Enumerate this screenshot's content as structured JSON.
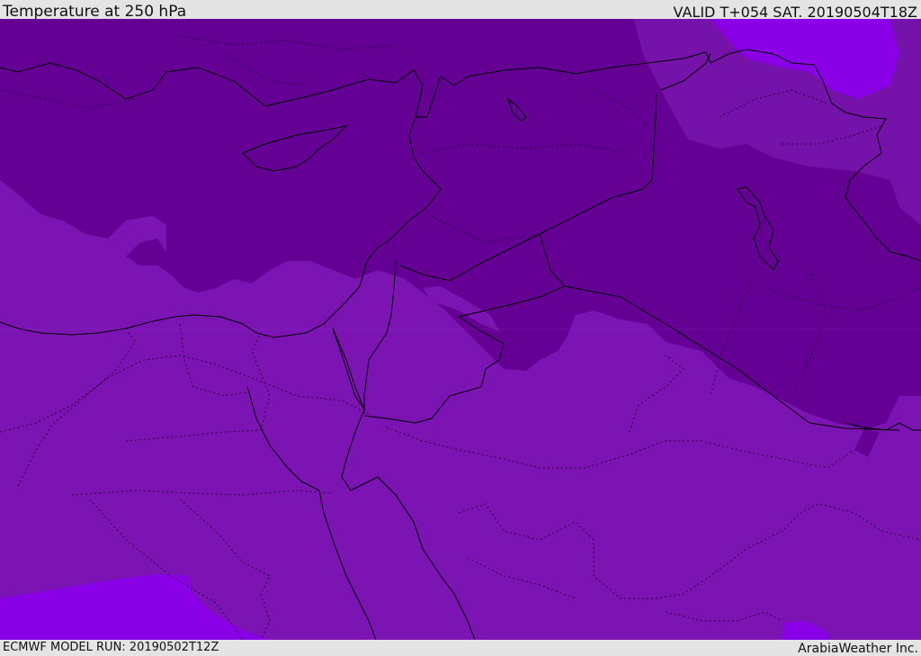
{
  "header": {
    "title": "Temperature at 250 hPa",
    "valid_time": "VALID T+054 SAT. 20190504T18Z"
  },
  "footer": {
    "model_run": "ECMWF MODEL RUN: 20190502T12Z",
    "credit": "ArabiaWeather Inc."
  },
  "colors": {
    "band_warm": "#7b14b2",
    "band_cold": "#640094",
    "band_mid": "#7412a9",
    "band_light": "#8a00e6",
    "coastline": "#000000",
    "border_dotted": "#2a0040"
  }
}
